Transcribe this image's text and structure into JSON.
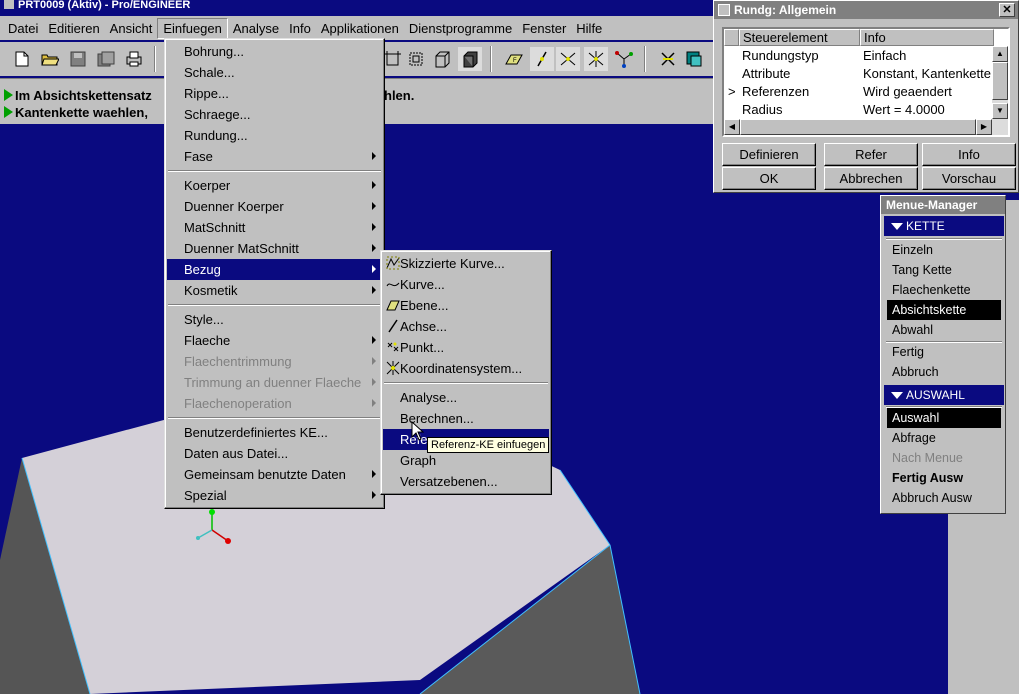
{
  "window": {
    "title": "PRT0009 (Aktiv) - Pro/ENGINEER"
  },
  "menubar": {
    "items": [
      "Datei",
      "Editieren",
      "Ansicht",
      "Einfuegen",
      "Analyse",
      "Info",
      "Applikationen",
      "Dienstprogramme",
      "Fenster",
      "Hilfe"
    ],
    "active": "Einfuegen"
  },
  "messages": [
    "Im Absichtskettensatz",
    "Kantenkette waehlen,",
    "hlen."
  ],
  "insert_menu": {
    "items": [
      {
        "label": "Bohrung..."
      },
      {
        "label": "Schale..."
      },
      {
        "label": "Rippe..."
      },
      {
        "label": "Schraege..."
      },
      {
        "label": "Rundung..."
      },
      {
        "label": "Fase"
      },
      {
        "label": "Koerper"
      },
      {
        "label": "Duenner Koerper"
      },
      {
        "label": "MatSchnitt"
      },
      {
        "label": "Duenner MatSchnitt"
      },
      {
        "label": "Bezug"
      },
      {
        "label": "Kosmetik"
      },
      {
        "label": "Style..."
      },
      {
        "label": "Flaeche"
      },
      {
        "label": "Flaechentrimmung"
      },
      {
        "label": "Trimmung an duenner Flaeche"
      },
      {
        "label": "Flaechenoperation"
      },
      {
        "label": "Benutzerdefiniertes KE..."
      },
      {
        "label": "Daten aus Datei..."
      },
      {
        "label": "Gemeinsam benutzte Daten"
      },
      {
        "label": "Spezial"
      }
    ]
  },
  "bezug_menu": {
    "items": [
      {
        "label": "Skizzierte Kurve..."
      },
      {
        "label": "Kurve..."
      },
      {
        "label": "Ebene..."
      },
      {
        "label": "Achse..."
      },
      {
        "label": "Punkt..."
      },
      {
        "label": "Koordinatensystem..."
      },
      {
        "label": "Analyse..."
      },
      {
        "label": "Berechnen..."
      },
      {
        "label": "Referenz..."
      },
      {
        "label": "Graph"
      },
      {
        "label": "Versatzebenen..."
      }
    ]
  },
  "tooltip": "Referenz-KE einfuegen",
  "dialog": {
    "title": "Rundg: Allgemein",
    "columns": [
      "Steuerelement",
      "Info"
    ],
    "rows": [
      {
        "element": "Rundungstyp",
        "info": "Einfach"
      },
      {
        "element": "Attribute",
        "info": "Konstant, Kantenkette"
      },
      {
        "element": "Referenzen",
        "info": "Wird geaendert",
        "marker": ">"
      },
      {
        "element": "Radius",
        "info": "Wert = 4.0000"
      }
    ],
    "buttons": [
      "Definieren",
      "Refer",
      "Info",
      "OK",
      "Abbrechen",
      "Vorschau"
    ]
  },
  "menu_manager": {
    "title": "Menue-Manager",
    "kette": {
      "header": "KETTE",
      "items": [
        "Einzeln",
        "Tang Kette",
        "Flaechenkette",
        "Absichtskette",
        "Abwahl",
        "Fertig",
        "Abbruch"
      ],
      "selected": "Absichtskette"
    },
    "auswahl": {
      "header": "AUSWAHL",
      "items": [
        "Auswahl",
        "Abfrage",
        "Nach Menue",
        "Fertig Ausw",
        "Abbruch Ausw"
      ],
      "selected": "Auswahl",
      "disabled": "Nach Menue"
    }
  }
}
